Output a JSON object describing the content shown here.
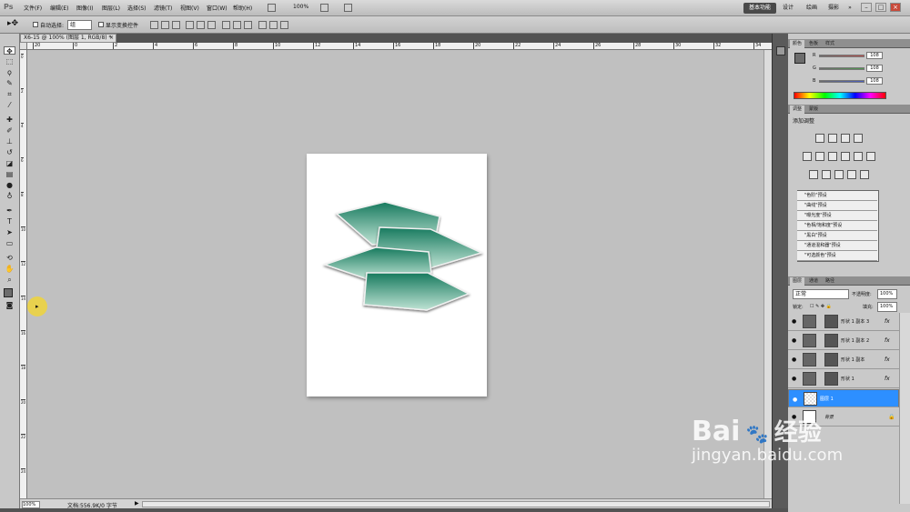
{
  "app": {
    "logo": "Ps"
  },
  "menu": [
    "文件(F)",
    "编辑(E)",
    "图像(I)",
    "图层(L)",
    "选择(S)",
    "滤镜(T)",
    "视图(V)",
    "窗口(W)",
    "帮助(H)"
  ],
  "zoom_menu": "100%",
  "workspaces": {
    "active": "基本功能",
    "items": [
      "设计",
      "绘画",
      "摄影"
    ],
    "more": "»"
  },
  "window_controls": {
    "minimize": "–",
    "restore": "□",
    "close": "×"
  },
  "options": {
    "auto_select_label": "自动选择:",
    "auto_select_value": "组",
    "show_transform_label": "显示变换控件"
  },
  "document": {
    "tab_title": "X6-15 @ 100% (图层 1, RGB/8) *",
    "close": "×"
  },
  "ruler_h": [
    "20",
    "0",
    "2",
    "4",
    "6",
    "8",
    "10",
    "12",
    "14",
    "16",
    "18",
    "20",
    "22",
    "24",
    "26",
    "28",
    "30",
    "32",
    "34"
  ],
  "ruler_v": [
    "0",
    "2",
    "4",
    "6",
    "8",
    "10",
    "12",
    "14",
    "16",
    "18",
    "20",
    "22",
    "24"
  ],
  "status": {
    "zoom": "100%",
    "doc_info": "文档:556.9K/0 字节",
    "arrow": "▶"
  },
  "color_panel": {
    "tabs": [
      "颜色",
      "色板",
      "样式"
    ],
    "channels": [
      {
        "label": "R",
        "value": "108",
        "color": "#c0504d"
      },
      {
        "label": "G",
        "value": "108",
        "color": "#4f9a4f"
      },
      {
        "label": "B",
        "value": "108",
        "color": "#4a5fc0"
      }
    ]
  },
  "adjustments_panel": {
    "tabs": [
      "调整",
      "蒙版"
    ],
    "title": "添加调整",
    "presets": [
      "\"色阶\"预设",
      "\"曲线\"预设",
      "\"曝光度\"预设",
      "\"色相/饱和度\"预设",
      "\"黑白\"预设",
      "\"通道混和器\"预设",
      "\"可选颜色\"预设"
    ]
  },
  "layers_panel": {
    "tabs": [
      "图层",
      "通道",
      "路径"
    ],
    "blend_mode": "正常",
    "opacity_label": "不透明度:",
    "opacity_value": "100%",
    "lock_label": "锁定:",
    "fill_label": "填充:",
    "fill_value": "100%",
    "fx_label": "fx",
    "layers": [
      {
        "name": "形状 1 副本 3",
        "type": "shape",
        "fx": true,
        "selected": false
      },
      {
        "name": "形状 1 副本 2",
        "type": "shape",
        "fx": true,
        "selected": false
      },
      {
        "name": "形状 1 副本",
        "type": "shape",
        "fx": true,
        "selected": false
      },
      {
        "name": "形状 1",
        "type": "shape",
        "fx": true,
        "selected": false
      },
      {
        "name": "图层 1",
        "type": "pixel",
        "fx": false,
        "selected": true
      },
      {
        "name": "背景",
        "type": "background",
        "fx": false,
        "selected": false
      }
    ]
  },
  "watermark": {
    "brand": "Bai",
    "brand2": "经验",
    "url": "jingyan.baidu.com"
  },
  "colors": {
    "shape_top": "#177a5e",
    "shape_bottom": "#bfe3d4",
    "outline": "#f0f0f0",
    "selection": "#2d8fff"
  }
}
